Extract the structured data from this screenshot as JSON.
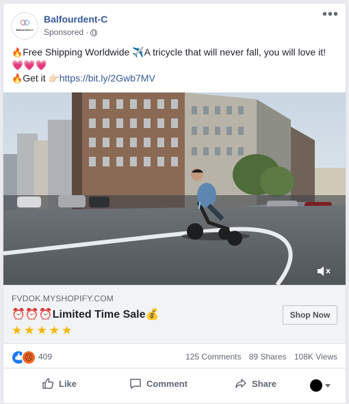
{
  "post": {
    "page_name": "Balfourdent-C",
    "avatar_text": "Balfourdent-C",
    "sponsored": "Sponsored",
    "more": "•••",
    "text_line1": "Free Shipping Worldwide ✈️A tricycle that will never fall, you will love it!",
    "text_hearts": "💗💗💗",
    "text_line3_prefix": "Get it",
    "link": "https://bit.ly/2Gwb7MV"
  },
  "ad": {
    "domain": "FVDOK.MYSHOPIFY.COM",
    "headline": "⏰⏰⏰Limited Time Sale💰",
    "stars": "★★★★★",
    "cta": "Shop Now"
  },
  "stats": {
    "reactions": "409",
    "comments": "125 Comments",
    "shares": "89 Shares",
    "views": "108K Views"
  },
  "actions": {
    "like": "Like",
    "comment": "Comment",
    "share": "Share"
  }
}
